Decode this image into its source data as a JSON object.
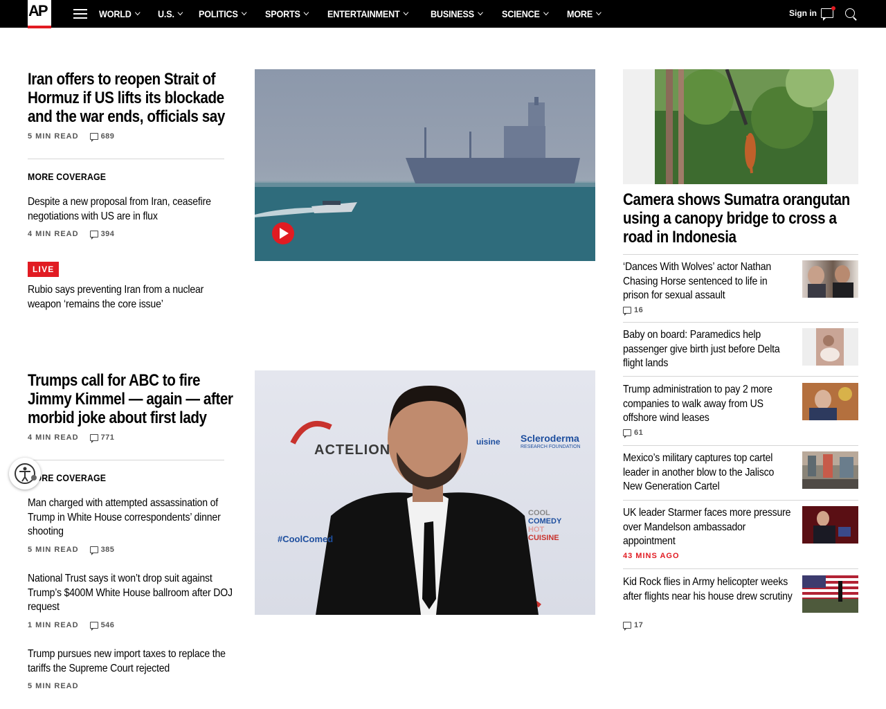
{
  "brand": {
    "logo_text": "AP",
    "accent": "#e11b22"
  },
  "nav": {
    "items": [
      "WORLD",
      "U.S.",
      "POLITICS",
      "SPORTS",
      "ENTERTAINMENT",
      "BUSINESS",
      "SCIENCE",
      "MORE"
    ],
    "signin": "Sign in"
  },
  "story1": {
    "headline": "Iran offers to reopen Strait of Hormuz if US lifts its blockade and the war ends, officials say",
    "read": "5 MIN READ",
    "comments": "689",
    "more_coverage": "MORE COVERAGE",
    "related": [
      {
        "headline": "Despite a new proposal from Iran, ceasefire negotiations with US are in flux",
        "read": "4 MIN READ",
        "comments": "394"
      },
      {
        "badge": "LIVE",
        "headline": "Rubio says preventing Iran from a nuclear weapon ‘remains the core issue’"
      }
    ]
  },
  "story2": {
    "headline": "Trumps call for ABC to fire Jimmy Kimmel — again — after morbid joke about first lady",
    "read": "4 MIN READ",
    "comments": "771",
    "more_coverage": "MORE COVERAGE",
    "related": [
      {
        "headline": "Man charged with attempted assassination of Trump in White House correspondents’ dinner shooting",
        "read": "5 MIN READ",
        "comments": "385"
      },
      {
        "headline": "National Trust says it won’t drop suit against Trump’s $400M White House ballroom after DOJ request",
        "read": "1 MIN READ",
        "comments": "546"
      },
      {
        "headline": "Trump pursues new import taxes to replace the tariffs the Supreme Court rejected",
        "read": "5 MIN READ"
      }
    ],
    "backdrop": {
      "brand1": "ACTELION",
      "brand2": "Scleroderma",
      "brand2_sub": "RESEARCH FOUNDATION",
      "hashtag": "#CoolComedy",
      "side1": "COOL",
      "side2": "COMEDY",
      "side3": "HOT",
      "side4": "CUISINE",
      "partial": "uisine"
    }
  },
  "sidebar": {
    "lead_headline": "Camera shows Sumatra orangutan using a canopy bridge to cross a road in Indonesia",
    "items": [
      {
        "headline": "‘Dances With Wolves’ actor Nathan Chasing Horse sentenced to life in prison for sexual assault",
        "comments": "16"
      },
      {
        "headline": "Baby on board: Paramedics help passenger give birth just before Delta flight lands"
      },
      {
        "headline": "Trump administration to pay 2 more companies to walk away from US offshore wind leases",
        "comments": "61"
      },
      {
        "headline": "Mexico’s military captures top cartel leader in another blow to the Jalisco New Generation Cartel"
      },
      {
        "headline": "UK leader Starmer faces more pressure over Mandelson ambassador appointment",
        "time": "43 MINS AGO"
      },
      {
        "headline": "Kid Rock flies in Army helicopter weeks after flights near his house drew scrutiny",
        "comments": "17"
      }
    ]
  }
}
